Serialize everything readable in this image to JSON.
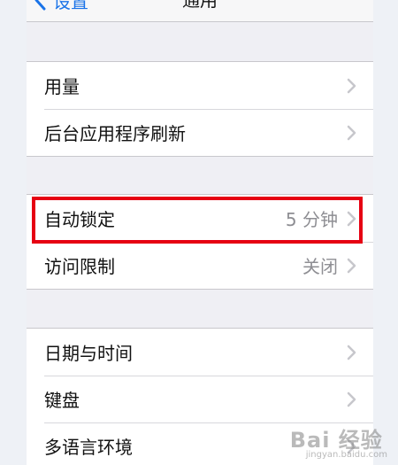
{
  "nav": {
    "back_label": "设置",
    "title": "通用"
  },
  "groups": [
    {
      "rows": [
        {
          "label": "用量"
        },
        {
          "label": "后台应用程序刷新"
        }
      ]
    },
    {
      "rows": [
        {
          "label": "自动锁定",
          "value": "5 分钟"
        },
        {
          "label": "访问限制",
          "value": "关闭"
        }
      ]
    },
    {
      "rows": [
        {
          "label": "日期与时间"
        },
        {
          "label": "键盘"
        },
        {
          "label": "多语言环境"
        }
      ]
    }
  ],
  "colors": {
    "accent": "#1a73e8",
    "highlight": "#e60012",
    "background": "#efeff4"
  },
  "icons": {
    "back": "chevron-left-icon",
    "row_arrow": "chevron-right-icon"
  },
  "watermark": {
    "brand": "Bai 经验",
    "url": "jingyan.baidu.com"
  }
}
